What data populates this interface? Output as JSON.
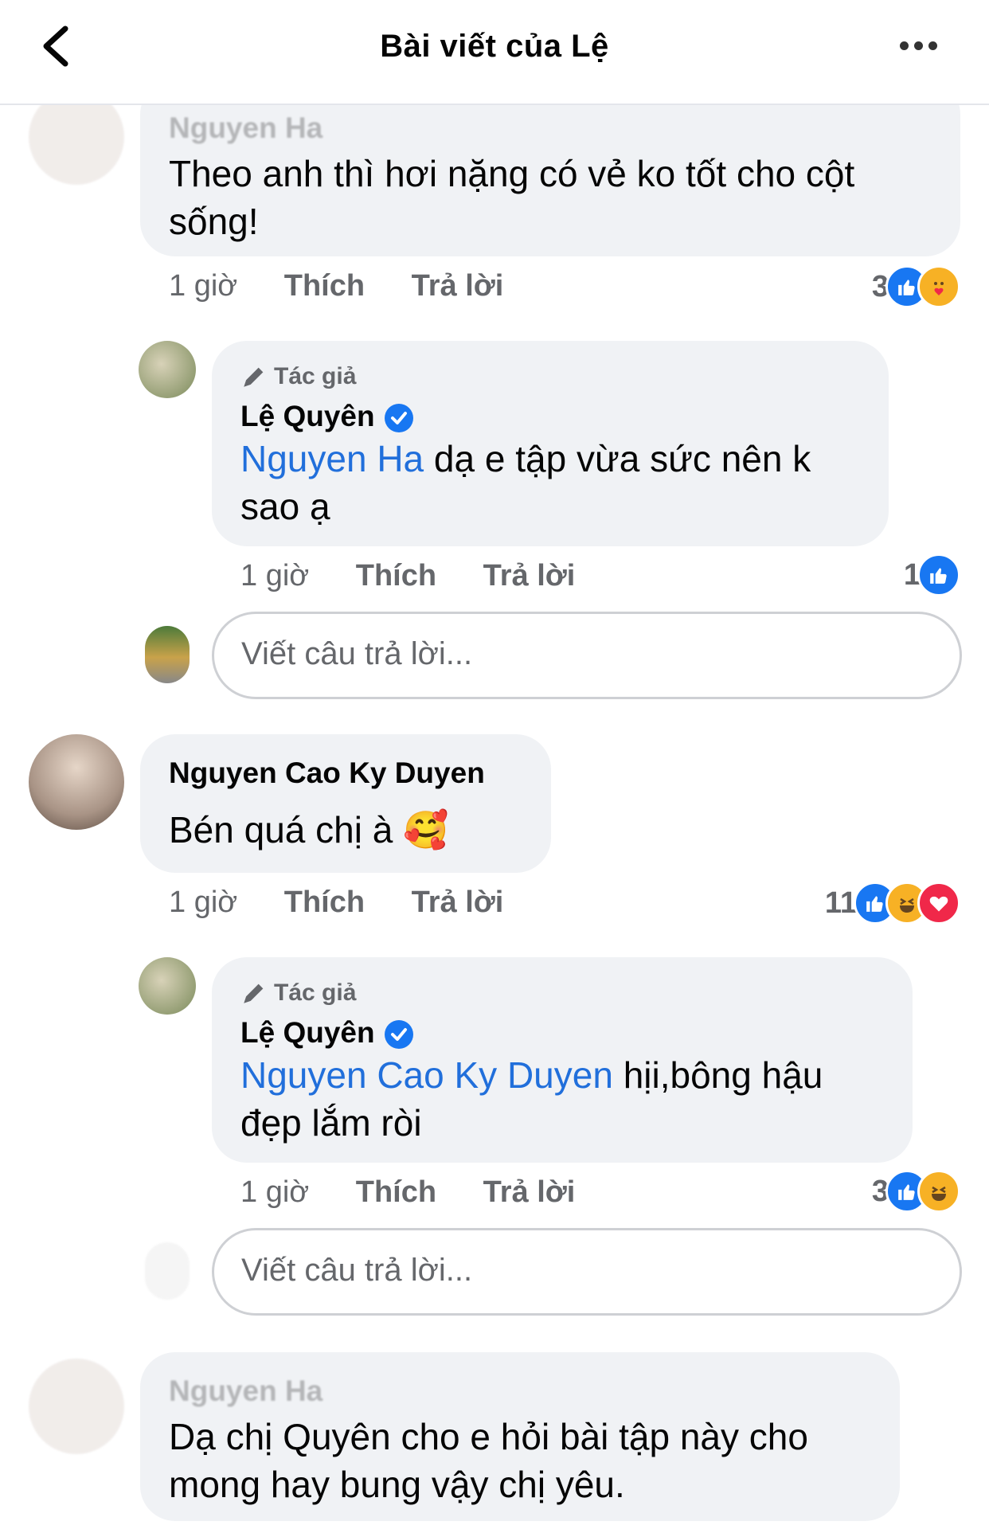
{
  "header": {
    "title": "Bài viết của Lệ"
  },
  "comments": [
    {
      "name": "Nguyen Ha",
      "text": "Theo anh thì hơi nặng có vẻ ko tốt cho cột sống!",
      "time": "1 giờ",
      "like": "Thích",
      "reply": "Trả lời",
      "reaction_count": "3",
      "reactions": [
        "like-icon",
        "care-icon"
      ]
    },
    {
      "author_tag": "Tác giả",
      "name": "Lệ Quyên",
      "mention": "Nguyen Ha",
      "text": " dạ e tập vừa sức nên k sao ạ",
      "time": "1 giờ",
      "like": "Thích",
      "reply": "Trả lời",
      "reaction_count": "1",
      "reactions": [
        "like-icon"
      ]
    },
    {
      "name": "Nguyen Cao Ky Duyen",
      "text": "Bén quá chị à 🥰",
      "time": "1 giờ",
      "like": "Thích",
      "reply": "Trả lời",
      "reaction_count": "11",
      "reactions": [
        "like-icon",
        "haha-icon",
        "love-icon"
      ]
    },
    {
      "author_tag": "Tác giả",
      "name": "Lệ Quyên",
      "mention": "Nguyen Cao Ky Duyen",
      "text": " hịi,bông hậu đẹp lắm ròi",
      "time": "1 giờ",
      "like": "Thích",
      "reply": "Trả lời",
      "reaction_count": "3",
      "reactions": [
        "like-icon",
        "haha-icon"
      ]
    },
    {
      "name": "Nguyen Ha",
      "text": "Dạ chị Quyên cho e hỏi bài tập này cho mong hay bung vậy chị yêu."
    }
  ],
  "reply_box": {
    "placeholder": "Viết câu trả lời..."
  },
  "colors": {
    "accent": "#1877f2",
    "mention": "#216fdb",
    "bubble": "#f0f2f5"
  }
}
